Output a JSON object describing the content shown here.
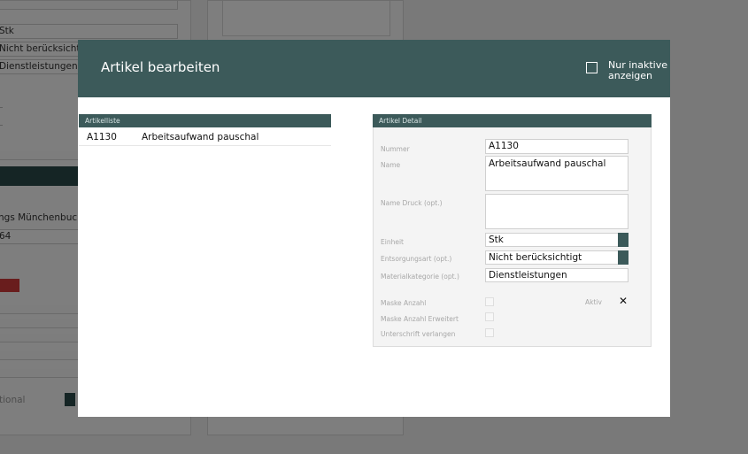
{
  "background": {
    "fields": [
      "Stk",
      "Nicht berücksichtigt",
      "Dienstleistungen"
    ],
    "location_text": "ngs Münchenbuchse",
    "code_text": "64",
    "placeholder_text": "tional"
  },
  "modal": {
    "title": "Artikel bearbeiten",
    "inactive_toggle_label": "Nur inaktive anzeigen",
    "list": {
      "header": "Artikelliste",
      "items": [
        {
          "code": "A1130",
          "name": "Arbeitsaufwand pauschal"
        }
      ]
    },
    "detail": {
      "header": "Artikel Detail",
      "labels": {
        "nummer": "Nummer",
        "name": "Name",
        "name_druck": "Name Druck (opt.)",
        "einheit": "Einheit",
        "entsorgungsart": "Entsorgungsart (opt.)",
        "materialkategorie": "Materialkategorie (opt.)",
        "maske_anzahl": "Maske Anzahl",
        "maske_anzahl_erweitert": "Maske Anzahl Erweitert",
        "unterschrift": "Unterschrift verlangen",
        "aktiv": "Aktiv"
      },
      "values": {
        "nummer": "A1130",
        "name": "Arbeitsaufwand pauschal",
        "name_druck": "",
        "einheit": "Stk",
        "entsorgungsart": "Nicht berücksichtigt",
        "materialkategorie": "Dienstleistungen",
        "aktiv_mark": "✕"
      }
    }
  }
}
